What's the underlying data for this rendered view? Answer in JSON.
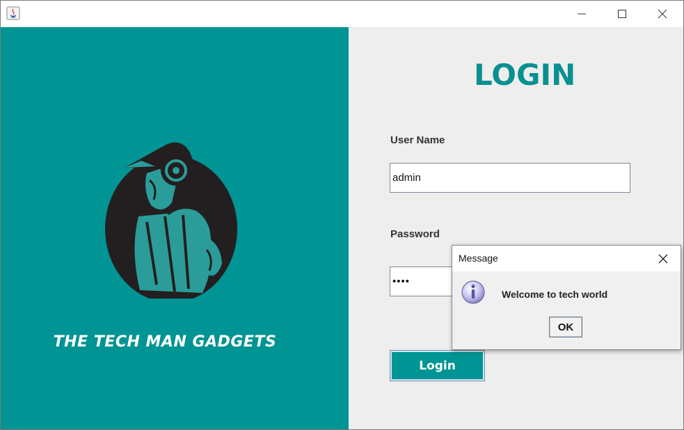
{
  "titlebar": {
    "app_icon": "java-icon",
    "controls": {
      "minimize": "minimize-icon",
      "maximize": "maximize-icon",
      "close": "close-icon"
    }
  },
  "left_panel": {
    "background": "#009494",
    "logo": "tech-man-logo",
    "brand_text": "THE TECH MAN GADGETS"
  },
  "login": {
    "title": "LOGIN",
    "title_color": "#0a9090",
    "username_label": "User Name",
    "username_value": "admin",
    "password_label": "Password",
    "password_value": "••••",
    "login_button": "Login"
  },
  "dialog": {
    "title": "Message",
    "icon": "info-icon",
    "message": "Welcome to tech world",
    "ok_label": "OK"
  }
}
